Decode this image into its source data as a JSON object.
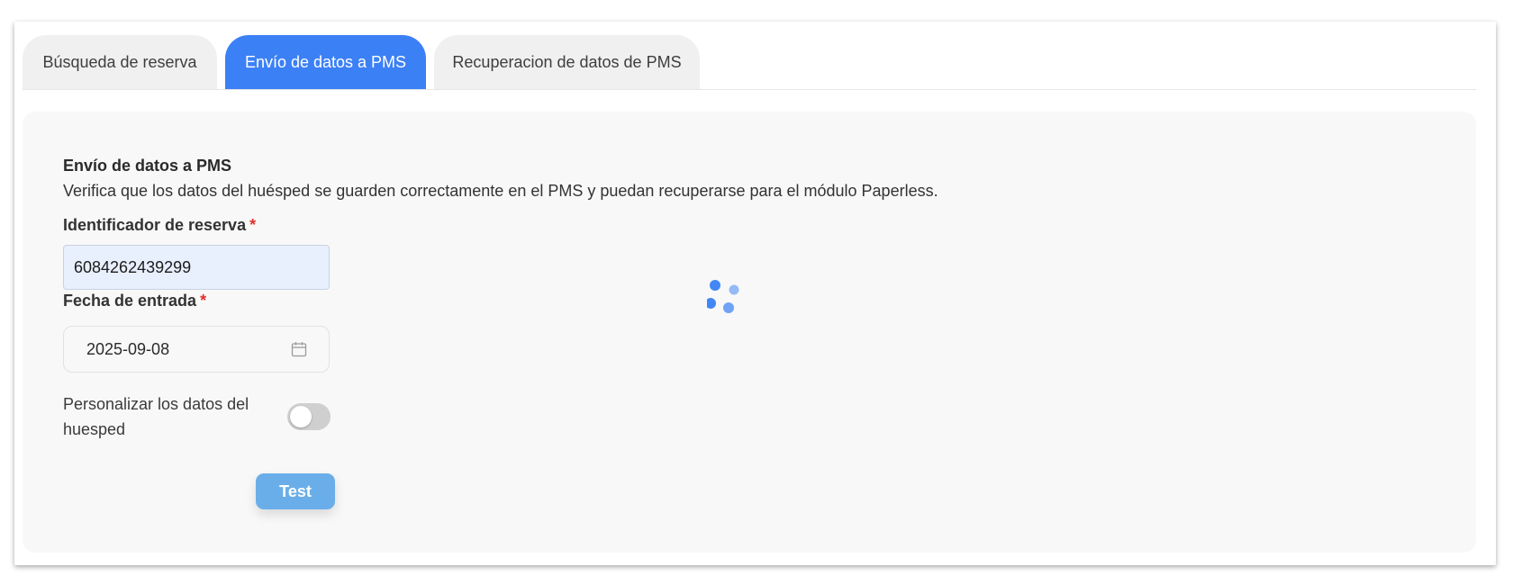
{
  "tabs": [
    {
      "label": "Búsqueda de reserva",
      "active": false
    },
    {
      "label": "Envío de datos a PMS",
      "active": true
    },
    {
      "label": "Recuperacion de datos de PMS",
      "active": false
    }
  ],
  "section": {
    "title": "Envío de datos a PMS",
    "description": "Verifica que los datos del huésped se guarden correctamente en el PMS y puedan recuperarse para el módulo Paperless."
  },
  "form": {
    "reserva_label": "Identificador de reserva",
    "reserva_value": "6084262439299",
    "fecha_label": "Fecha de entrada",
    "fecha_value": "2025-09-08",
    "required_mark": "*",
    "toggle_label": "Personalizar los datos del huesped",
    "toggle_on": false,
    "test_label": "Test"
  },
  "colors": {
    "accent": "#3c80f6",
    "button": "#6aaee9",
    "required": "#e0302b"
  },
  "icons": {
    "fecha": "calendar-icon",
    "loading": "loading-spinner-icon"
  }
}
